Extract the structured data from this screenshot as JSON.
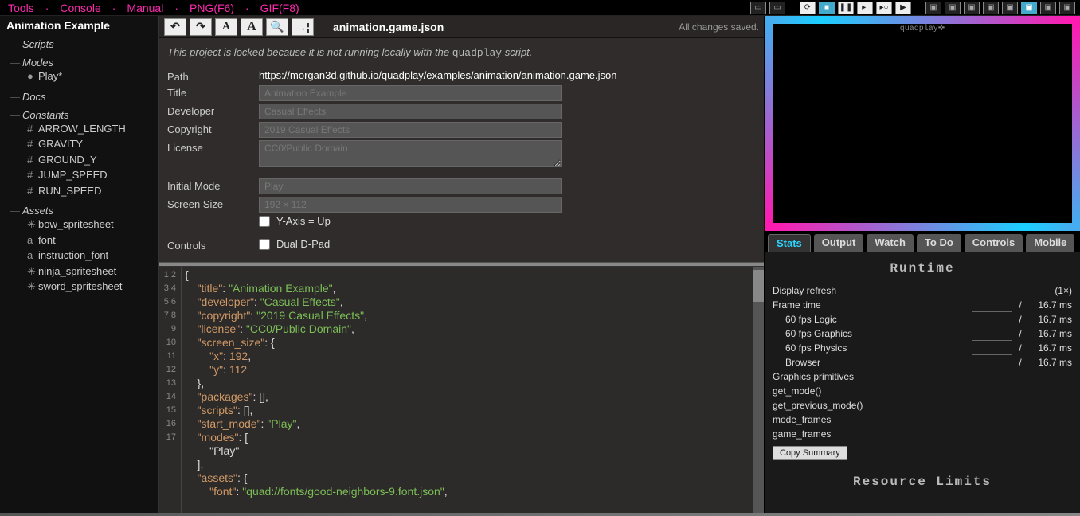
{
  "topmenu": [
    "Tools",
    "Console",
    "Manual",
    "PNG(F6)",
    "GIF(F8)"
  ],
  "project_title": "Animation Example",
  "tree": {
    "scripts": "Scripts",
    "modes": "Modes",
    "modes_items": [
      "Play*"
    ],
    "docs": "Docs",
    "constants": "Constants",
    "constants_items": [
      "ARROW_LENGTH",
      "GRAVITY",
      "GROUND_Y",
      "JUMP_SPEED",
      "RUN_SPEED"
    ],
    "assets": "Assets",
    "assets_items": [
      "bow_spritesheet",
      "font",
      "instruction_font",
      "ninja_spritesheet",
      "sword_spritesheet"
    ]
  },
  "filename": "animation.game.json",
  "saved_msg": "All changes saved.",
  "locked_msg_a": "This project is locked because it is not running locally with the ",
  "locked_msg_b": "quadplay",
  "locked_msg_c": " script.",
  "form": {
    "path_label": "Path",
    "path": "https://morgan3d.github.io/quadplay/examples/animation/animation.game.json",
    "title_label": "Title",
    "title": "Animation Example",
    "developer_label": "Developer",
    "developer": "Casual Effects",
    "copyright_label": "Copyright",
    "copyright": "2019 Casual Effects",
    "license_label": "License",
    "license": "CC0/Public Domain",
    "initmode_label": "Initial Mode",
    "initmode": "Play",
    "screensize_label": "Screen Size",
    "screensize": "192 × 112",
    "yaxis_label": "Y-Axis = Up",
    "controls_label": "Controls",
    "dual_label": "Dual D-Pad"
  },
  "code_lines": [
    "{",
    "    \"title\": \"Animation Example\",",
    "    \"developer\": \"Casual Effects\",",
    "    \"copyright\": \"2019 Casual Effects\",",
    "    \"license\": \"CC0/Public Domain\",",
    "    \"screen_size\": {",
    "        \"x\": 192,",
    "        \"y\": 112",
    "    },",
    "    \"packages\": [],",
    "    \"scripts\": [],",
    "    \"start_mode\": \"Play\",",
    "    \"modes\": [",
    "        \"Play\"",
    "    ],",
    "    \"assets\": {",
    "        \"font\": \"quad://fonts/good-neighbors-9.font.json\","
  ],
  "preview_brand": "quadplay✜",
  "tabs": [
    "Stats",
    "Output",
    "Watch",
    "To Do",
    "Controls",
    "Mobile"
  ],
  "runtime_header": "Runtime",
  "stats": {
    "refresh": "Display refresh",
    "refresh_mult": "(1×)",
    "frame": "Frame time",
    "frame_v": "16.7 ms",
    "logic": "60 fps Logic",
    "logic_v": "16.7 ms",
    "graphics": "60 fps Graphics",
    "graphics_v": "16.7 ms",
    "physics": "60 fps Physics",
    "physics_v": "16.7 ms",
    "browser": "Browser",
    "browser_v": "16.7 ms",
    "prim": "Graphics primitives",
    "getmode": "get_mode()",
    "getprev": "get_previous_mode()",
    "modef": "mode_frames",
    "gamef": "game_frames"
  },
  "copy_summary": "Copy Summary",
  "resource_header": "Resource Limits"
}
